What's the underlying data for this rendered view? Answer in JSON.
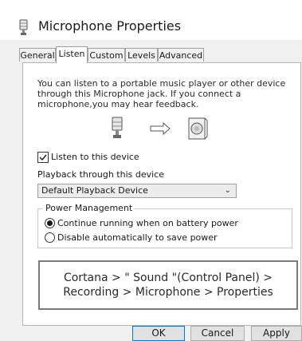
{
  "window": {
    "title": "Microphone Properties"
  },
  "tabs": [
    {
      "label": "General"
    },
    {
      "label": "Listen"
    },
    {
      "label": "Custom"
    },
    {
      "label": "Levels"
    },
    {
      "label": "Advanced"
    }
  ],
  "active_tab": "Listen",
  "listen": {
    "description": "You can listen to a portable music player or other device through this Microphone jack. If you connect a microphone,you may hear feedback.",
    "listen_checkbox": {
      "label": "Listen to this device",
      "checked": true
    },
    "playback_label": "Playback through this device",
    "playback_select": {
      "value": "Default Playback Device"
    },
    "power_group": {
      "legend": "Power Management",
      "options": [
        {
          "label": "Continue running when on battery power",
          "selected": true
        },
        {
          "label": "Disable automatically to save power",
          "selected": false
        }
      ]
    }
  },
  "callout": {
    "line1": "Cortana > \" Sound \"(Control Panel) >",
    "line2": "Recording > Microphone > Properties"
  },
  "buttons": {
    "ok": "OK",
    "cancel": "Cancel",
    "apply": "Apply"
  },
  "icons": {
    "title": "microphone-icon",
    "mic": "microphone-icon",
    "arrow": "right-arrow-icon",
    "speaker": "speaker-icon"
  },
  "colors": {
    "ok_border": "#0078d7",
    "panel_bg": "#ffffff",
    "window_bg": "#f0f0f0"
  }
}
